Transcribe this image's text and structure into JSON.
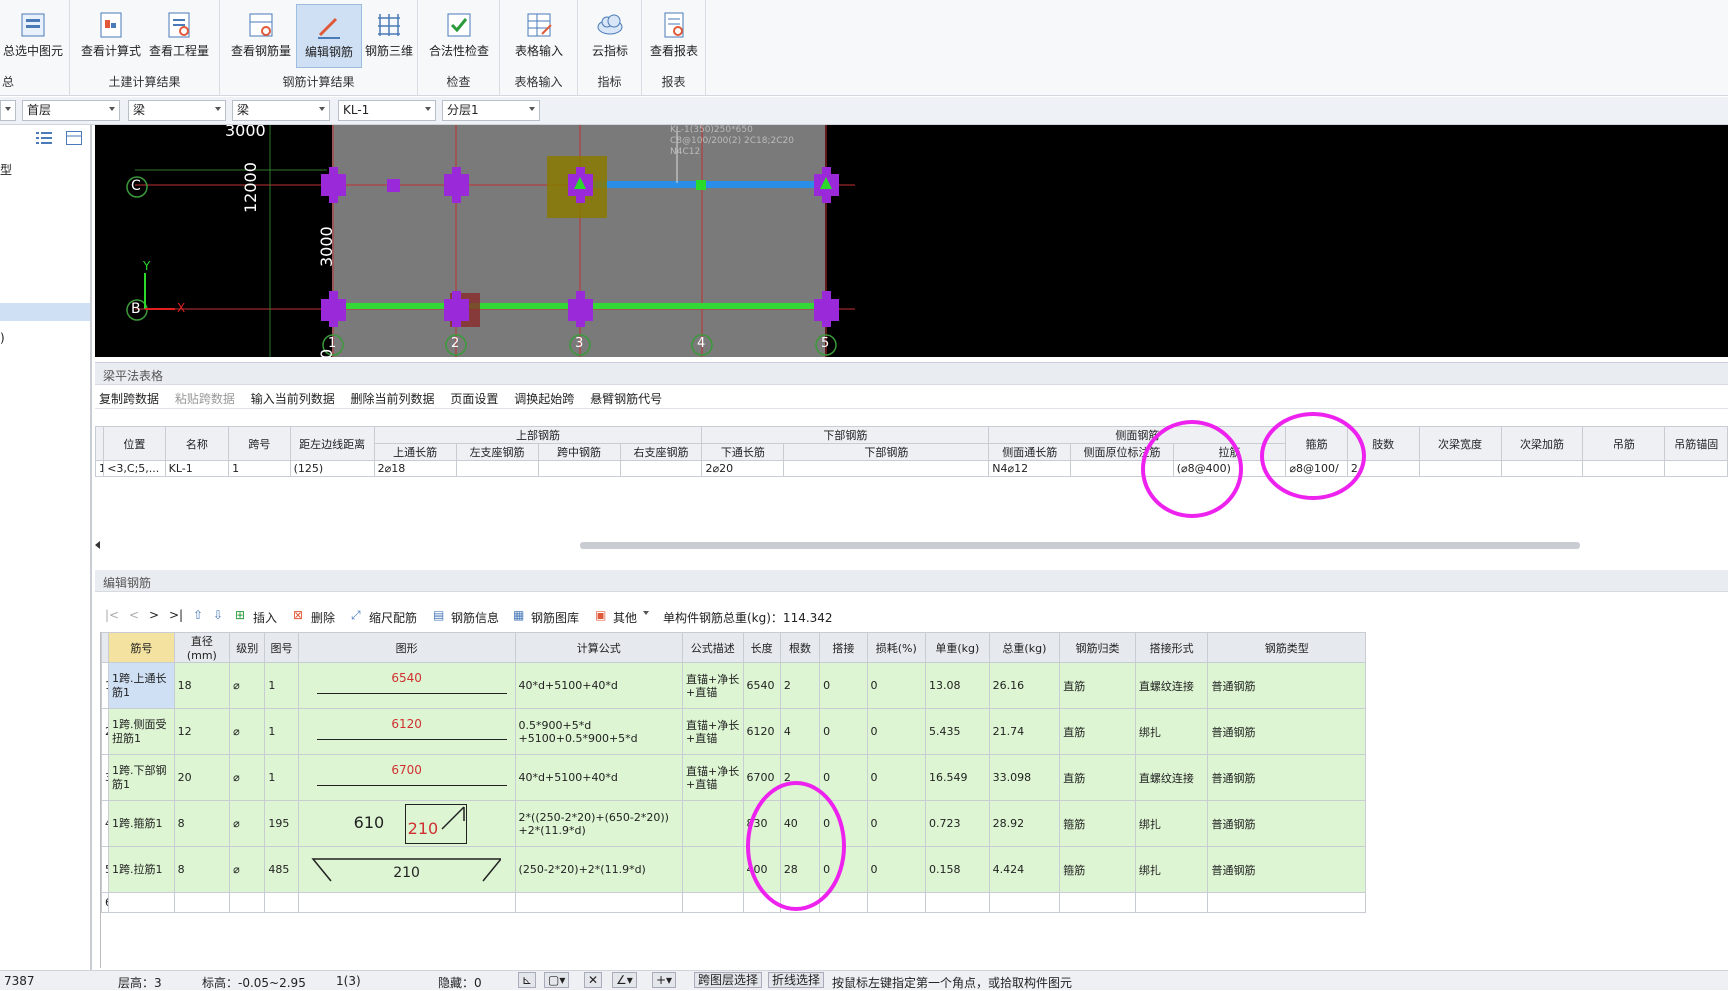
{
  "ribbon": {
    "groups": [
      {
        "label": "总",
        "buttons": [
          {
            "label": "总选中图元"
          }
        ]
      },
      {
        "label": "土建计算结果",
        "buttons": [
          {
            "label": "查看计算式"
          },
          {
            "label": "查看工程量"
          }
        ]
      },
      {
        "label": "钢筋计算结果",
        "buttons": [
          {
            "label": "查看钢筋量"
          },
          {
            "label": "编辑钢筋"
          },
          {
            "label": "钢筋三维"
          }
        ]
      },
      {
        "label": "检查",
        "buttons": [
          {
            "label": "合法性检查"
          }
        ]
      },
      {
        "label": "表格输入",
        "buttons": [
          {
            "label": "表格输入"
          }
        ]
      },
      {
        "label": "指标",
        "buttons": [
          {
            "label": "云指标"
          }
        ]
      },
      {
        "label": "报表",
        "buttons": [
          {
            "label": "查看报表"
          }
        ]
      }
    ]
  },
  "selectors": {
    "floor": "首层",
    "type": "梁",
    "subtype": "梁",
    "component": "KL-1",
    "layer": "分层1"
  },
  "left_panel": {
    "item1": "型",
    "item2": ")"
  },
  "canvas": {
    "axis_rows": [
      "C",
      "B"
    ],
    "axis_cols": [
      "1",
      "2",
      "3",
      "4",
      "5"
    ],
    "dims": [
      "12000",
      "3000",
      "3000",
      "0"
    ],
    "annotation": [
      "KL-1(350)250*650",
      "C8@100/200(2) 2C18;2C20",
      "N4C12"
    ],
    "y_label": "Y",
    "x_label": "X"
  },
  "beam_table": {
    "title": "梁平法表格",
    "toolbar": [
      "复制跨数据",
      "粘贴跨数据",
      "输入当前列数据",
      "删除当前列数据",
      "页面设置",
      "调换起始跨",
      "悬臂钢筋代号"
    ],
    "group_headers": {
      "top": "上部钢筋",
      "bottom": "下部钢筋",
      "side": "侧面钢筋"
    },
    "headers": [
      "位置",
      "名称",
      "跨号",
      "距左边线距离",
      "上通长筋",
      "左支座钢筋",
      "跨中钢筋",
      "右支座钢筋",
      "下通长筋",
      "下部钢筋",
      "侧面通长筋",
      "侧面原位标注筋",
      "拉筋",
      "箍筋",
      "肢数",
      "次梁宽度",
      "次梁加筋",
      "吊筋",
      "吊筋锚固"
    ],
    "row": {
      "index": "1",
      "cells": [
        "<3,C;5,...",
        "KL-1",
        "1",
        "(125)",
        "2⌀18",
        "",
        "",
        "",
        "2⌀20",
        "",
        "N4⌀12",
        "",
        "(⌀8@400)",
        "⌀8@100/",
        "2",
        "",
        "",
        "",
        ""
      ]
    }
  },
  "edit_rebar": {
    "title": "编辑钢筋",
    "toolbar": {
      "insert": "插入",
      "delete": "删除",
      "scale": "缩尺配筋",
      "info": "钢筋信息",
      "library": "钢筋图库",
      "other": "其他",
      "total_label": "单构件钢筋总重(kg)：114.342"
    },
    "headers": [
      "筋号",
      "直径(mm)",
      "级别",
      "图号",
      "图形",
      "计算公式",
      "公式描述",
      "长度",
      "根数",
      "搭接",
      "损耗(%)",
      "单重(kg)",
      "总重(kg)",
      "钢筋归类",
      "搭接形式",
      "钢筋类型"
    ],
    "rows": [
      {
        "no": "1",
        "name": "1跨.上通长筋1",
        "dia": "18",
        "grade": "⌀",
        "fig": "1",
        "shape": "6540",
        "formula": "40*d+5100+40*d",
        "desc": "直锚+净长+直锚",
        "len": "6540",
        "count": "2",
        "lap": "0",
        "loss": "0",
        "unit": "13.08",
        "total": "26.16",
        "cat": "直筋",
        "lapform": "直螺纹连接",
        "type": "普通钢筋"
      },
      {
        "no": "2",
        "name": "1跨.侧面受扭筋1",
        "dia": "12",
        "grade": "⌀",
        "fig": "1",
        "shape": "6120",
        "formula": "0.5*900+5*d +5100+0.5*900+5*d",
        "desc": "直锚+净长+直锚",
        "len": "6120",
        "count": "4",
        "lap": "0",
        "loss": "0",
        "unit": "5.435",
        "total": "21.74",
        "cat": "直筋",
        "lapform": "绑扎",
        "type": "普通钢筋"
      },
      {
        "no": "3",
        "name": "1跨.下部钢筋1",
        "dia": "20",
        "grade": "⌀",
        "fig": "1",
        "shape": "6700",
        "formula": "40*d+5100+40*d",
        "desc": "直锚+净长+直锚",
        "len": "6700",
        "count": "2",
        "lap": "0",
        "loss": "0",
        "unit": "16.549",
        "total": "33.098",
        "cat": "直筋",
        "lapform": "直螺纹连接",
        "type": "普通钢筋"
      },
      {
        "no": "4",
        "name": "1跨.箍筋1",
        "dia": "8",
        "grade": "⌀",
        "fig": "195",
        "shape": "610|210",
        "formula": "2*((250-2*20)+(650-2*20)) +2*(11.9*d)",
        "desc": "",
        "len": "830",
        "count": "40",
        "lap": "0",
        "loss": "0",
        "unit": "0.723",
        "total": "28.92",
        "cat": "箍筋",
        "lapform": "绑扎",
        "type": "普通钢筋"
      },
      {
        "no": "5",
        "name": "1跨.拉筋1",
        "dia": "8",
        "grade": "⌀",
        "fig": "485",
        "shape": "210",
        "formula": "(250-2*20)+2*(11.9*d)",
        "desc": "",
        "len": "400",
        "count": "28",
        "lap": "0",
        "loss": "0",
        "unit": "0.158",
        "total": "4.424",
        "cat": "箍筋",
        "lapform": "绑扎",
        "type": "普通钢筋"
      },
      {
        "no": "6",
        "name": "",
        "dia": "",
        "grade": "",
        "fig": "",
        "shape": "",
        "formula": "",
        "desc": "",
        "len": "",
        "count": "",
        "lap": "",
        "loss": "",
        "unit": "",
        "total": "",
        "cat": "",
        "lapform": "",
        "type": ""
      }
    ]
  },
  "status": {
    "coord": "7387",
    "floor_height": "层高：3",
    "elevation": "标高：-0.05~2.95",
    "count": "1(3)",
    "hidden": "隐藏：0",
    "btn1": "跨图层选择",
    "btn2": "折线选择",
    "hint": "按鼠标左键指定第一个角点，或拾取构件图元"
  },
  "colors": {
    "accent": "#ee22ee",
    "green_row": "#ddf5d3",
    "canvas_bg": "#000000"
  }
}
